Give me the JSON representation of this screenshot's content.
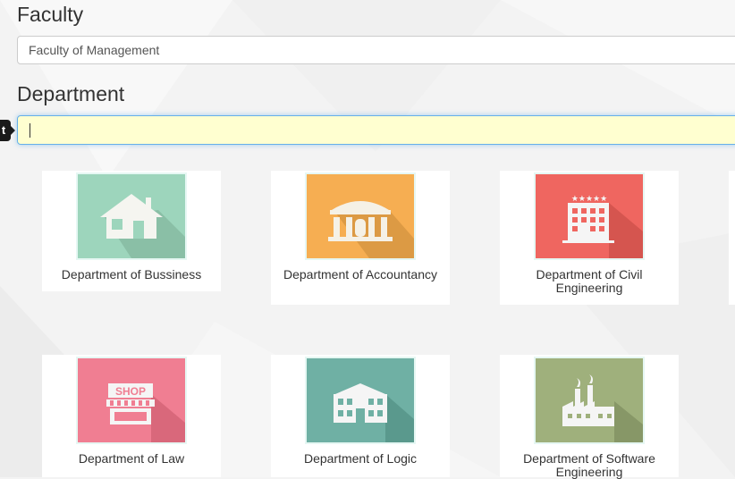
{
  "faculty": {
    "label": "Faculty",
    "value": "Faculty of Management"
  },
  "department": {
    "label": "Department",
    "value": "",
    "tooltip_text": "t"
  },
  "departments": [
    {
      "name": "Department of Bussiness",
      "icon": "house-icon",
      "color": "#9dd5bc"
    },
    {
      "name": "Department of Accountancy",
      "icon": "bank-icon",
      "color": "#f6ae52"
    },
    {
      "name": "Department of Civil Engineering",
      "icon": "hotel-building-icon",
      "color": "#ef6660"
    },
    {
      "name": "Department of Law",
      "icon": "shop-icon",
      "color": "#f07e92"
    },
    {
      "name": "Department of Logic",
      "icon": "school-building-icon",
      "color": "#6fb0a4"
    },
    {
      "name": "Department of Software Engineering",
      "icon": "factory-icon",
      "color": "#9fb07c"
    }
  ],
  "shop_sign": "SHOP"
}
